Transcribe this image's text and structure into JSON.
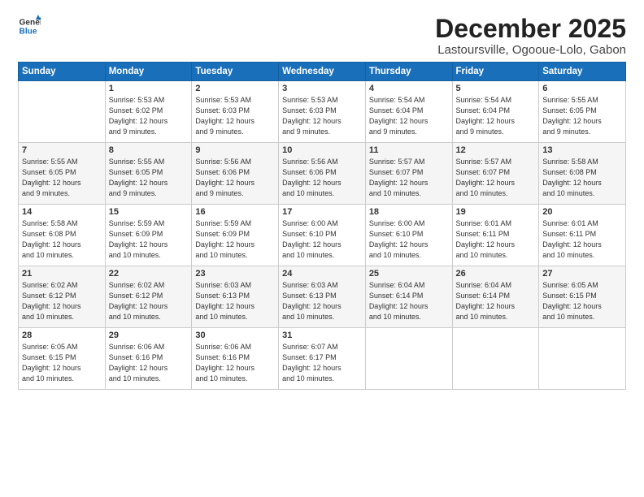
{
  "header": {
    "logo_line1": "General",
    "logo_line2": "Blue",
    "title": "December 2025",
    "subtitle": "Lastoursville, Ogooue-Lolo, Gabon"
  },
  "days_of_week": [
    "Sunday",
    "Monday",
    "Tuesday",
    "Wednesday",
    "Thursday",
    "Friday",
    "Saturday"
  ],
  "weeks": [
    [
      {
        "day": "",
        "info": ""
      },
      {
        "day": "1",
        "info": "Sunrise: 5:53 AM\nSunset: 6:02 PM\nDaylight: 12 hours\nand 9 minutes."
      },
      {
        "day": "2",
        "info": "Sunrise: 5:53 AM\nSunset: 6:03 PM\nDaylight: 12 hours\nand 9 minutes."
      },
      {
        "day": "3",
        "info": "Sunrise: 5:53 AM\nSunset: 6:03 PM\nDaylight: 12 hours\nand 9 minutes."
      },
      {
        "day": "4",
        "info": "Sunrise: 5:54 AM\nSunset: 6:04 PM\nDaylight: 12 hours\nand 9 minutes."
      },
      {
        "day": "5",
        "info": "Sunrise: 5:54 AM\nSunset: 6:04 PM\nDaylight: 12 hours\nand 9 minutes."
      },
      {
        "day": "6",
        "info": "Sunrise: 5:55 AM\nSunset: 6:05 PM\nDaylight: 12 hours\nand 9 minutes."
      }
    ],
    [
      {
        "day": "7",
        "info": "Sunrise: 5:55 AM\nSunset: 6:05 PM\nDaylight: 12 hours\nand 9 minutes."
      },
      {
        "day": "8",
        "info": "Sunrise: 5:55 AM\nSunset: 6:05 PM\nDaylight: 12 hours\nand 9 minutes."
      },
      {
        "day": "9",
        "info": "Sunrise: 5:56 AM\nSunset: 6:06 PM\nDaylight: 12 hours\nand 9 minutes."
      },
      {
        "day": "10",
        "info": "Sunrise: 5:56 AM\nSunset: 6:06 PM\nDaylight: 12 hours\nand 10 minutes."
      },
      {
        "day": "11",
        "info": "Sunrise: 5:57 AM\nSunset: 6:07 PM\nDaylight: 12 hours\nand 10 minutes."
      },
      {
        "day": "12",
        "info": "Sunrise: 5:57 AM\nSunset: 6:07 PM\nDaylight: 12 hours\nand 10 minutes."
      },
      {
        "day": "13",
        "info": "Sunrise: 5:58 AM\nSunset: 6:08 PM\nDaylight: 12 hours\nand 10 minutes."
      }
    ],
    [
      {
        "day": "14",
        "info": "Sunrise: 5:58 AM\nSunset: 6:08 PM\nDaylight: 12 hours\nand 10 minutes."
      },
      {
        "day": "15",
        "info": "Sunrise: 5:59 AM\nSunset: 6:09 PM\nDaylight: 12 hours\nand 10 minutes."
      },
      {
        "day": "16",
        "info": "Sunrise: 5:59 AM\nSunset: 6:09 PM\nDaylight: 12 hours\nand 10 minutes."
      },
      {
        "day": "17",
        "info": "Sunrise: 6:00 AM\nSunset: 6:10 PM\nDaylight: 12 hours\nand 10 minutes."
      },
      {
        "day": "18",
        "info": "Sunrise: 6:00 AM\nSunset: 6:10 PM\nDaylight: 12 hours\nand 10 minutes."
      },
      {
        "day": "19",
        "info": "Sunrise: 6:01 AM\nSunset: 6:11 PM\nDaylight: 12 hours\nand 10 minutes."
      },
      {
        "day": "20",
        "info": "Sunrise: 6:01 AM\nSunset: 6:11 PM\nDaylight: 12 hours\nand 10 minutes."
      }
    ],
    [
      {
        "day": "21",
        "info": "Sunrise: 6:02 AM\nSunset: 6:12 PM\nDaylight: 12 hours\nand 10 minutes."
      },
      {
        "day": "22",
        "info": "Sunrise: 6:02 AM\nSunset: 6:12 PM\nDaylight: 12 hours\nand 10 minutes."
      },
      {
        "day": "23",
        "info": "Sunrise: 6:03 AM\nSunset: 6:13 PM\nDaylight: 12 hours\nand 10 minutes."
      },
      {
        "day": "24",
        "info": "Sunrise: 6:03 AM\nSunset: 6:13 PM\nDaylight: 12 hours\nand 10 minutes."
      },
      {
        "day": "25",
        "info": "Sunrise: 6:04 AM\nSunset: 6:14 PM\nDaylight: 12 hours\nand 10 minutes."
      },
      {
        "day": "26",
        "info": "Sunrise: 6:04 AM\nSunset: 6:14 PM\nDaylight: 12 hours\nand 10 minutes."
      },
      {
        "day": "27",
        "info": "Sunrise: 6:05 AM\nSunset: 6:15 PM\nDaylight: 12 hours\nand 10 minutes."
      }
    ],
    [
      {
        "day": "28",
        "info": "Sunrise: 6:05 AM\nSunset: 6:15 PM\nDaylight: 12 hours\nand 10 minutes."
      },
      {
        "day": "29",
        "info": "Sunrise: 6:06 AM\nSunset: 6:16 PM\nDaylight: 12 hours\nand 10 minutes."
      },
      {
        "day": "30",
        "info": "Sunrise: 6:06 AM\nSunset: 6:16 PM\nDaylight: 12 hours\nand 10 minutes."
      },
      {
        "day": "31",
        "info": "Sunrise: 6:07 AM\nSunset: 6:17 PM\nDaylight: 12 hours\nand 10 minutes."
      },
      {
        "day": "",
        "info": ""
      },
      {
        "day": "",
        "info": ""
      },
      {
        "day": "",
        "info": ""
      }
    ]
  ]
}
